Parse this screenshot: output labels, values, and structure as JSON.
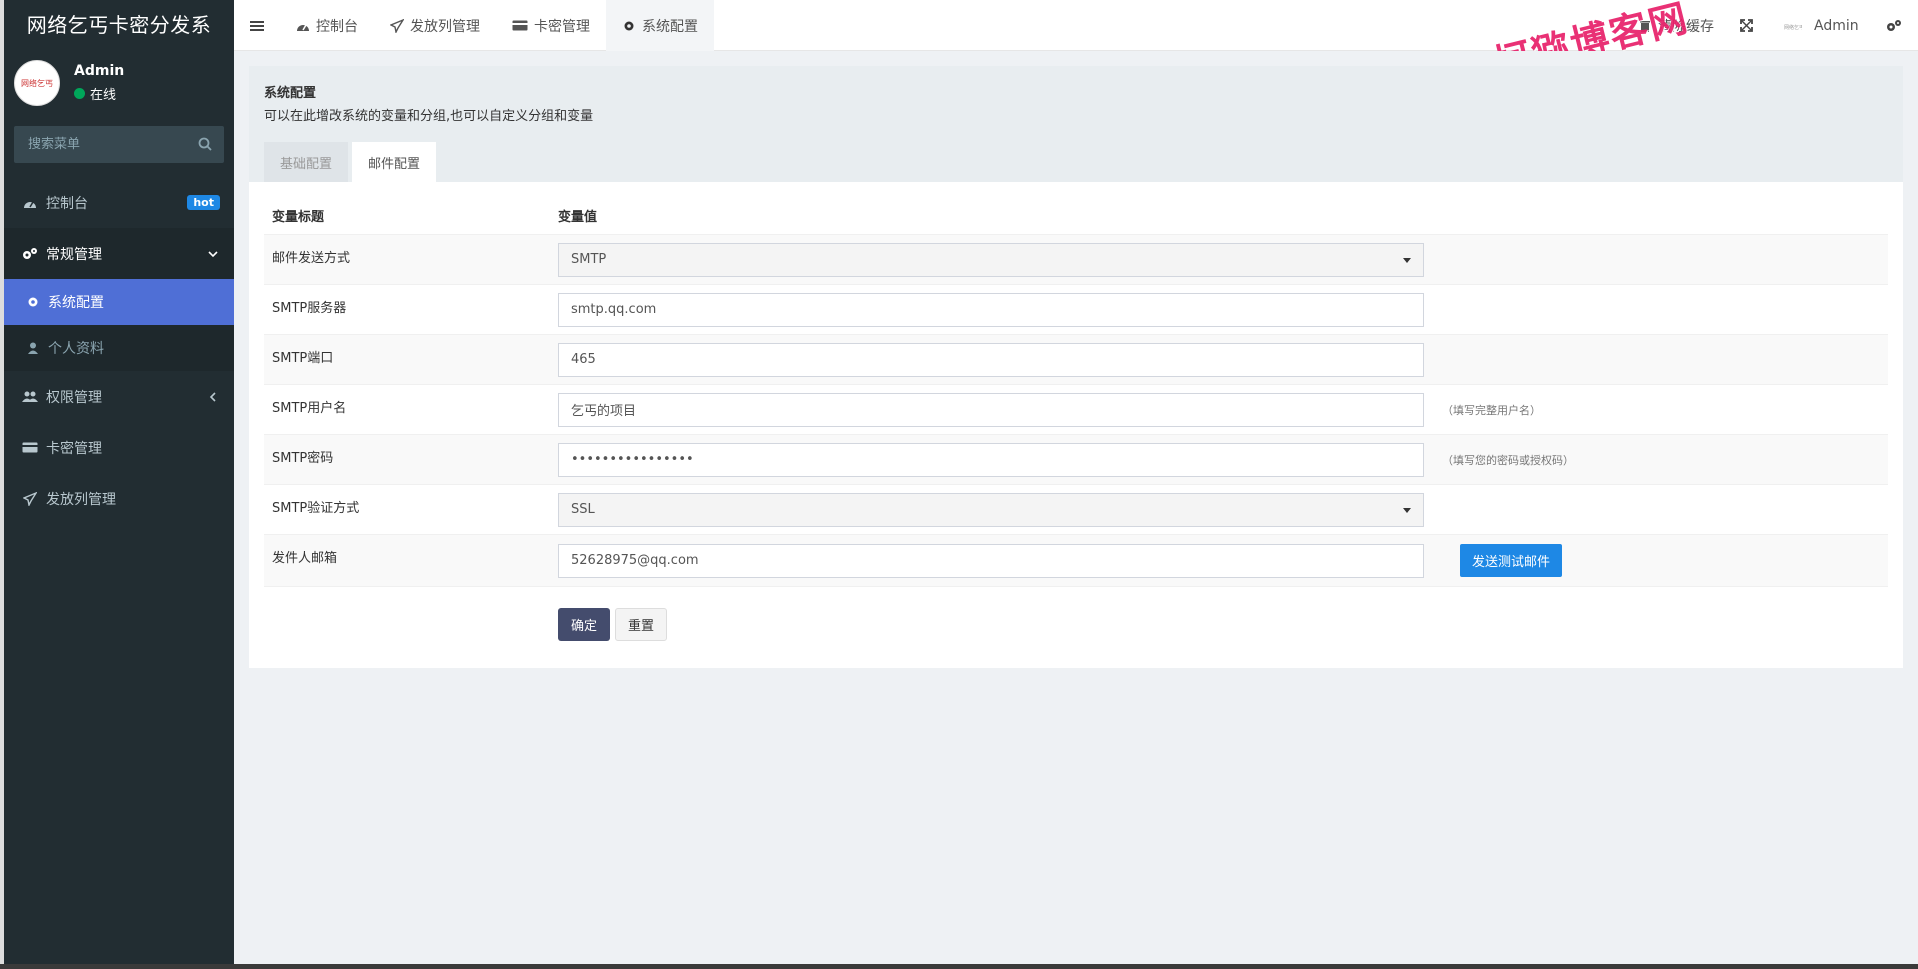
{
  "app": {
    "title": "网络乞丐卡密分发系"
  },
  "user": {
    "name": "Admin",
    "status": "在线",
    "avatar_text": "网络乞丐"
  },
  "sidebar": {
    "search_placeholder": "搜索菜单",
    "items": [
      {
        "label": "控制台",
        "badge": "hot"
      },
      {
        "label": "常规管理"
      },
      {
        "label": "系统配置"
      },
      {
        "label": "个人资料"
      },
      {
        "label": "权限管理"
      },
      {
        "label": "卡密管理"
      },
      {
        "label": "发放列管理"
      }
    ]
  },
  "header": {
    "tabs": [
      {
        "label": "控制台"
      },
      {
        "label": "发放列管理"
      },
      {
        "label": "卡密管理"
      },
      {
        "label": "系统配置"
      }
    ],
    "clear_cache": "清除缓存",
    "admin": "Admin",
    "watermark": "柯猕博客网"
  },
  "panel": {
    "title": "系统配置",
    "description": "可以在此增改系统的变量和分组,也可以自定义分组和变量",
    "tabs": [
      {
        "label": "基础配置"
      },
      {
        "label": "邮件配置"
      }
    ]
  },
  "form": {
    "col_title": "变量标题",
    "col_value": "变量值",
    "rows": [
      {
        "label": "邮件发送方式",
        "value": "SMTP"
      },
      {
        "label": "SMTP服务器",
        "value": "smtp.qq.com"
      },
      {
        "label": "SMTP端口",
        "value": "465"
      },
      {
        "label": "SMTP用户名",
        "value": "乞丐的项目",
        "hint": "（填写完整用户名）"
      },
      {
        "label": "SMTP密码",
        "value": "••••••••••••••••",
        "hint": "（填写您的密码或授权码）"
      },
      {
        "label": "SMTP验证方式",
        "value": "SSL"
      },
      {
        "label": "发件人邮箱",
        "value": "52628975@qq.com"
      }
    ],
    "test_button": "发送测试邮件",
    "ok_button": "确定",
    "reset_button": "重置"
  }
}
